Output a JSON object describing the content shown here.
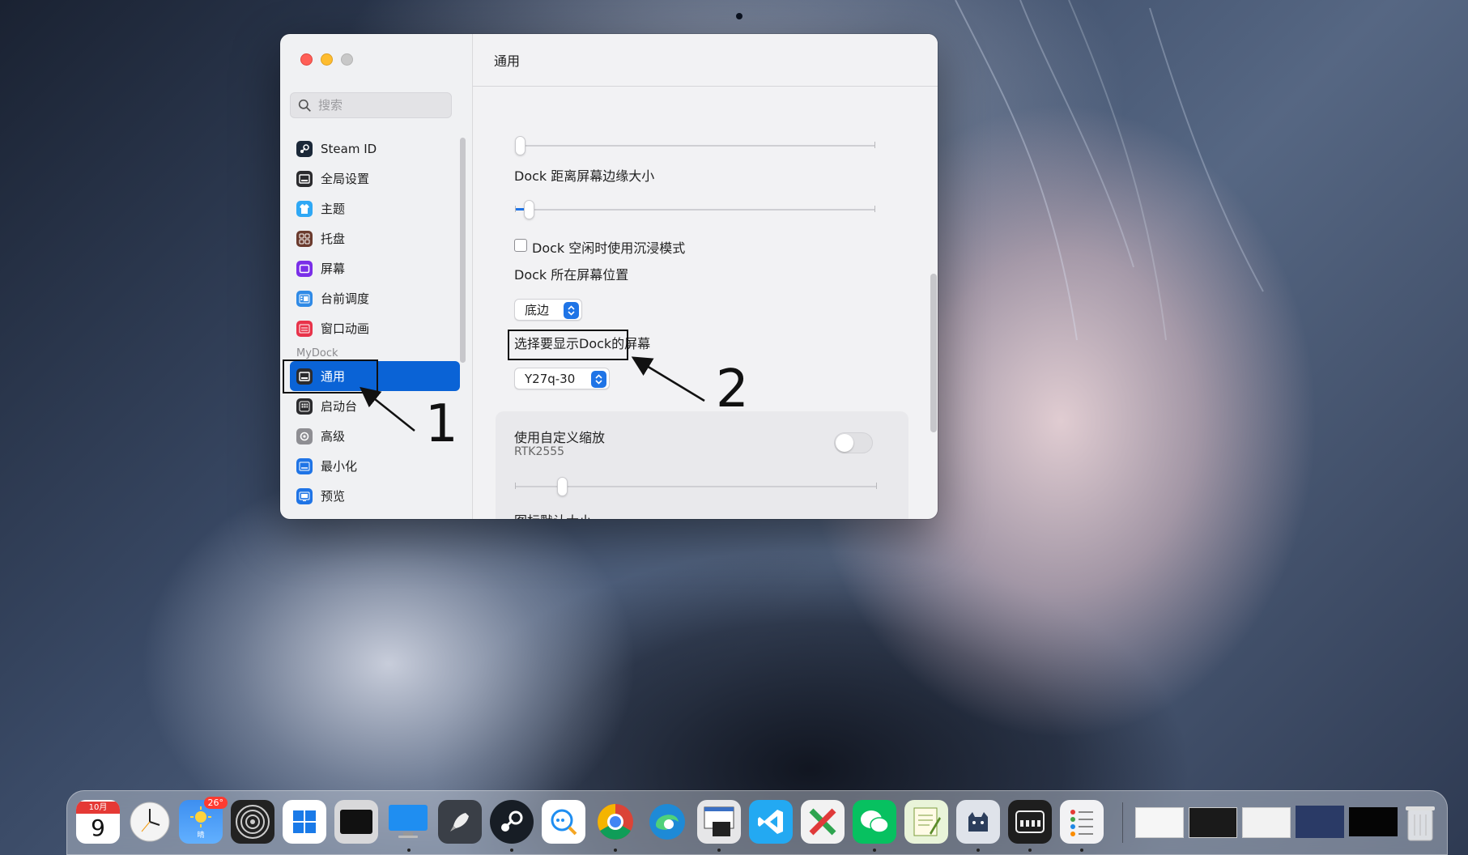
{
  "window": {
    "header_title": "通用",
    "search_placeholder": "搜索"
  },
  "sidebar": {
    "items_top": [
      {
        "label": "Steam ID",
        "icon": "steam-icon",
        "color": "#1b2838"
      },
      {
        "label": "全局设置",
        "icon": "display-icon",
        "color": "#2b2b2e"
      },
      {
        "label": "主题",
        "icon": "shirt-icon",
        "color": "#2fa8f5"
      },
      {
        "label": "托盘",
        "icon": "tray-grid-icon",
        "color": "#6b3b2e"
      },
      {
        "label": "屏幕",
        "icon": "screen-icon",
        "color": "#7a2ee8"
      },
      {
        "label": "台前调度",
        "icon": "stage-manager-icon",
        "color": "#2f8ae6"
      },
      {
        "label": "窗口动画",
        "icon": "window-animation-icon",
        "color": "#e8334a"
      }
    ],
    "section_label": "MyDock",
    "items_mydock": [
      {
        "label": "通用",
        "icon": "dock-general-icon",
        "color": "#2b2b2e",
        "active": true
      },
      {
        "label": "启动台",
        "icon": "launchpad-icon",
        "color": "#2b2b2e"
      },
      {
        "label": "高级",
        "icon": "advanced-gear-icon",
        "color": "#8e8e93"
      },
      {
        "label": "最小化",
        "icon": "minimize-icon",
        "color": "#1f74e6"
      },
      {
        "label": "预览",
        "icon": "preview-icon",
        "color": "#1f74e6"
      }
    ]
  },
  "settings": {
    "dock_margin_label": "Dock 距离屏幕边缘大小",
    "dock_margin_value": 0.03,
    "immersive_label": "Dock 空闲时使用沉浸模式",
    "immersive_checked": false,
    "position_label": "Dock 所在屏幕位置",
    "position_value": "底边",
    "screen_label": "选择要显示Dock的屏幕",
    "screen_value": "Y27q-30",
    "custom_scale_label": "使用自定义缩放",
    "custom_scale_sub": "RTK2555",
    "custom_scale_on": false,
    "custom_scale_value": 0.13,
    "icon_size_label": "图标默认大小"
  },
  "annotations": {
    "marker_1": "1",
    "marker_2": "2"
  },
  "dock": {
    "calendar_month": "10月",
    "calendar_day": "9",
    "weather_badge": "26°",
    "weather_sub": "晴",
    "accent": "#1f74e6",
    "apps": [
      {
        "name": "calendar",
        "icon": "calendar-icon"
      },
      {
        "name": "clock",
        "icon": "clock-icon"
      },
      {
        "name": "weather",
        "icon": "weather-icon"
      },
      {
        "name": "target",
        "icon": "target-rings-icon"
      },
      {
        "name": "windows",
        "icon": "windows-logo-icon"
      },
      {
        "name": "terminal",
        "icon": "terminal-icon"
      },
      {
        "name": "desktop",
        "icon": "monitor-icon"
      },
      {
        "name": "rocket",
        "icon": "rocket-icon"
      },
      {
        "name": "steam",
        "icon": "steam-icon"
      },
      {
        "name": "chat-search",
        "icon": "chat-bubble-icon"
      },
      {
        "name": "chrome",
        "icon": "chrome-icon"
      },
      {
        "name": "edge",
        "icon": "edge-icon"
      },
      {
        "name": "screen-tool",
        "icon": "screen-tool-icon"
      },
      {
        "name": "vscode",
        "icon": "vscode-icon"
      },
      {
        "name": "xmind",
        "icon": "xmind-icon"
      },
      {
        "name": "wechat",
        "icon": "wechat-icon"
      },
      {
        "name": "notepad",
        "icon": "notepad-icon"
      },
      {
        "name": "cat",
        "icon": "cat-icon"
      },
      {
        "name": "mydock",
        "icon": "mydock-icon"
      },
      {
        "name": "list",
        "icon": "list-icon"
      }
    ]
  }
}
